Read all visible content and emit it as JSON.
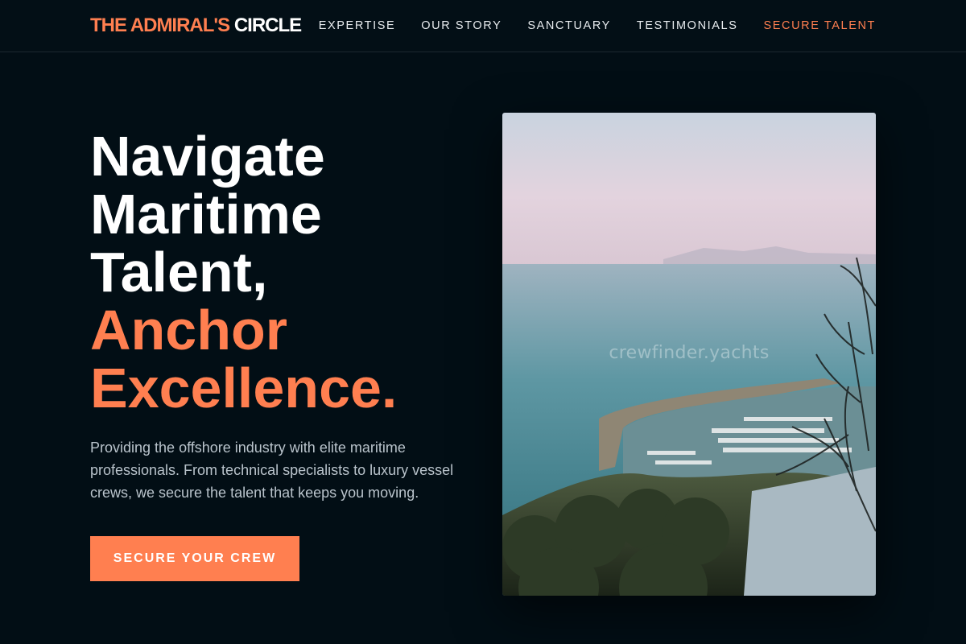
{
  "brand": {
    "part1": "THE ADMIRAL'S",
    "part2": "CIRCLE"
  },
  "nav": {
    "items": [
      {
        "label": "EXPERTISE"
      },
      {
        "label": "OUR STORY"
      },
      {
        "label": "SANCTUARY"
      },
      {
        "label": "TESTIMONIALS"
      },
      {
        "label": "SECURE TALENT"
      }
    ]
  },
  "hero": {
    "title_lines": [
      "Navigate",
      "Maritime",
      "Talent,"
    ],
    "title_accent_lines": [
      "Anchor",
      "Excellence."
    ],
    "subtitle": "Providing the offshore industry with elite maritime professionals. From technical specialists to luxury vessel crews, we secure the talent that keeps you moving.",
    "cta_label": "SECURE YOUR CREW",
    "image": {
      "watermark": "crewfinder.yachts",
      "icon": "harbor-photo"
    }
  },
  "colors": {
    "accent": "#ff7f50",
    "background": "#020e15"
  }
}
